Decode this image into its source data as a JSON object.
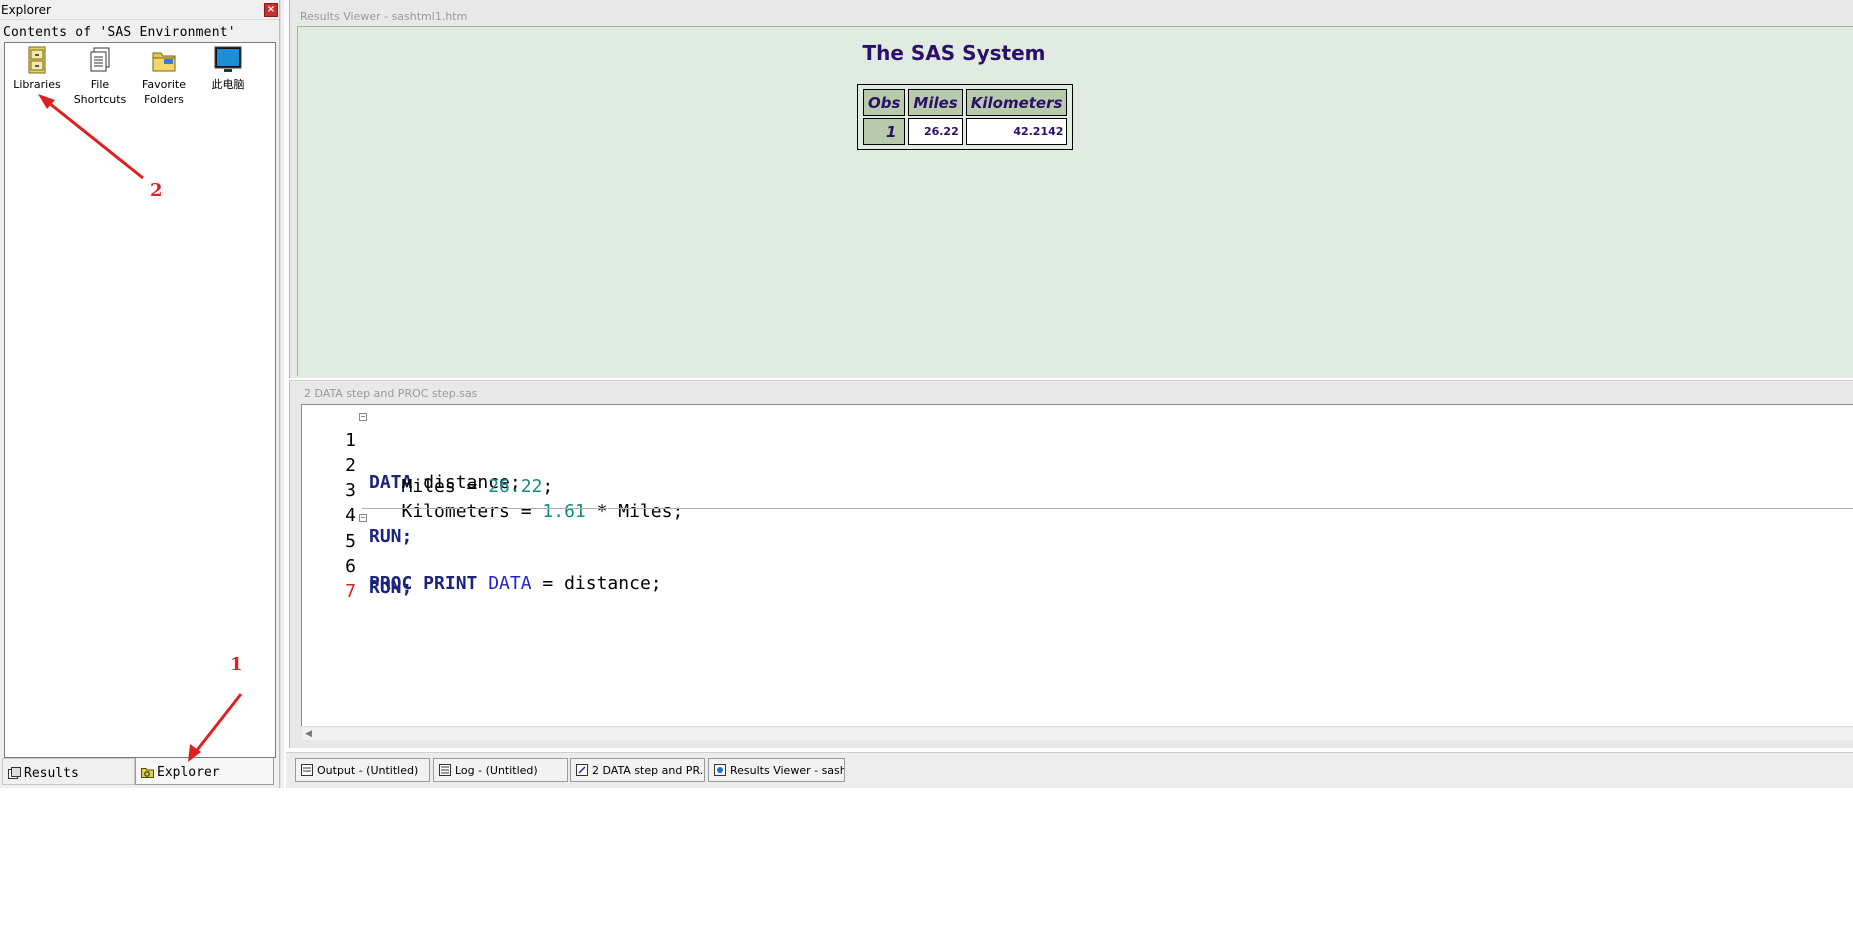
{
  "explorer": {
    "title": "Explorer",
    "close_glyph": "×",
    "contents_label": "Contents of 'SAS Environment'",
    "icons": [
      {
        "label": "Libraries",
        "icon": "file-cabinet-icon"
      },
      {
        "label": "File\nShortcuts",
        "icon": "file-shortcuts-icon"
      },
      {
        "label": "Favorite\nFolders",
        "icon": "favorite-folders-icon"
      },
      {
        "label": "此电脑",
        "icon": "computer-monitor-icon"
      }
    ],
    "tabs": [
      {
        "label": "Results",
        "icon": "results-icon"
      },
      {
        "label": "Explorer",
        "icon": "explorer-icon"
      }
    ]
  },
  "results_viewer": {
    "title": "Results Viewer - sashtml1.htm",
    "heading": "The SAS System",
    "table": {
      "headers": [
        "Obs",
        "Miles",
        "Kilometers"
      ],
      "rows": [
        [
          "1",
          "26.22",
          "42.2142"
        ]
      ]
    }
  },
  "editor": {
    "title": "2 DATA step and PROC step.sas",
    "lines": [
      {
        "n": "1",
        "fold": true
      },
      {
        "n": "2"
      },
      {
        "n": "3"
      },
      {
        "n": "4"
      },
      {
        "n": "5",
        "fold": true
      },
      {
        "n": "6"
      },
      {
        "n": "7",
        "current": true
      }
    ],
    "tokens": {
      "data_kw": "DATA",
      "distance_stmt": " distance;",
      "miles_assign": "   Miles = ",
      "miles_value": "26.22",
      "semicolon": ";",
      "km_assign": "   Kilometers = ",
      "factor": "1.61",
      "times_miles": " * Miles;",
      "run_kw": "RUN;",
      "proc_kw": "PROC PRINT",
      "data_opt": "DATA",
      "eq_distance": " = distance;"
    }
  },
  "taskbar": [
    {
      "label": "Output - (Untitled)",
      "icon": "output-icon"
    },
    {
      "label": "Log - (Untitled)",
      "icon": "log-icon"
    },
    {
      "label": "2 DATA step and PR...",
      "icon": "program-editor-icon"
    },
    {
      "label": "Results Viewer - sash...",
      "icon": "results-viewer-icon"
    }
  ],
  "annotations": [
    {
      "label": "1",
      "color": "#e02020"
    },
    {
      "label": "2",
      "color": "#e02020"
    }
  ],
  "colors": {
    "results_background": "#e0ece1",
    "table_header": "#b7cbaa",
    "title_text": "#2b0f6a",
    "keyword": "#1a237e",
    "number": "#108a88",
    "annotation": "#e02020"
  }
}
